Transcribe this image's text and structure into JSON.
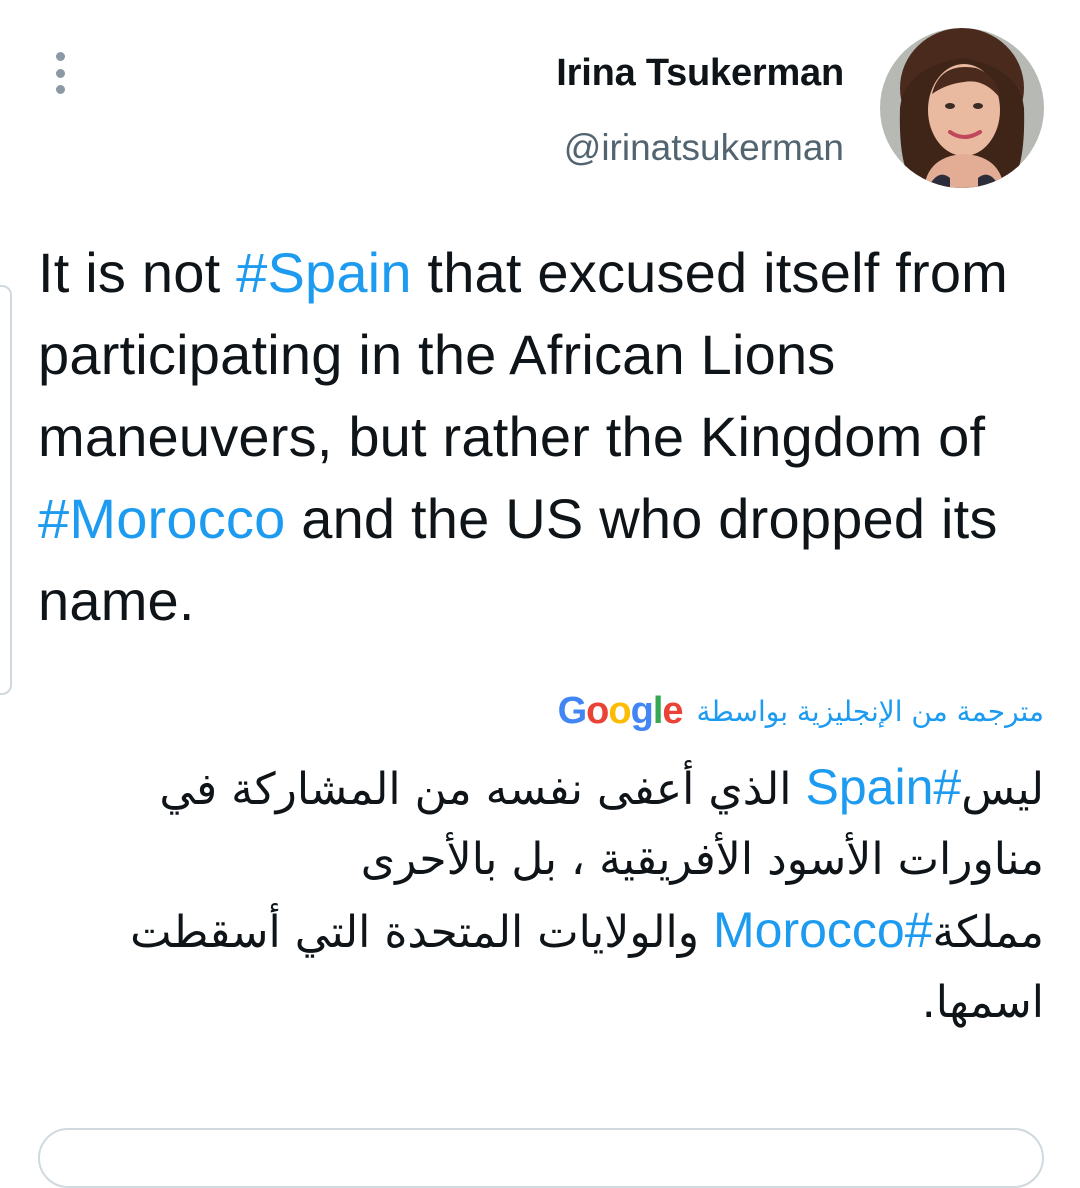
{
  "author": {
    "name": "Irina Tsukerman",
    "handle": "@irinatsukerman"
  },
  "tweet": {
    "text_before_1": "It is not ",
    "hashtag_1": "#Spain",
    "text_between": " that excused itself from participating in the African Lions maneuvers, but rather the Kingdom of ",
    "hashtag_2": "#Morocco",
    "text_after": " and the US who dropped its name."
  },
  "translation": {
    "label": "مترجمة من الإنجليزية بواسطة",
    "provider": {
      "letters": [
        "G",
        "o",
        "o",
        "g",
        "l",
        "e"
      ],
      "colors": [
        "#4285F4",
        "#EA4335",
        "#FBBC05",
        "#4285F4",
        "#34A853",
        "#EA4335"
      ]
    },
    "text_1": "ليس",
    "hashtag_1": "#Spain",
    "text_2": " الذي أعفى نفسه من المشاركة في مناورات الأسود الأفريقية ، بل بالأحرى مملكة",
    "hashtag_2": "#Morocco",
    "text_3": " والولايات المتحدة التي أسقطت اسمها."
  },
  "icons": {
    "more": "more-vertical-icon",
    "avatar": "profile-photo"
  },
  "colors": {
    "link": "#1d9bf0",
    "secondary_text": "#536471",
    "primary_text": "#0f1419",
    "border": "#cfd9de"
  }
}
